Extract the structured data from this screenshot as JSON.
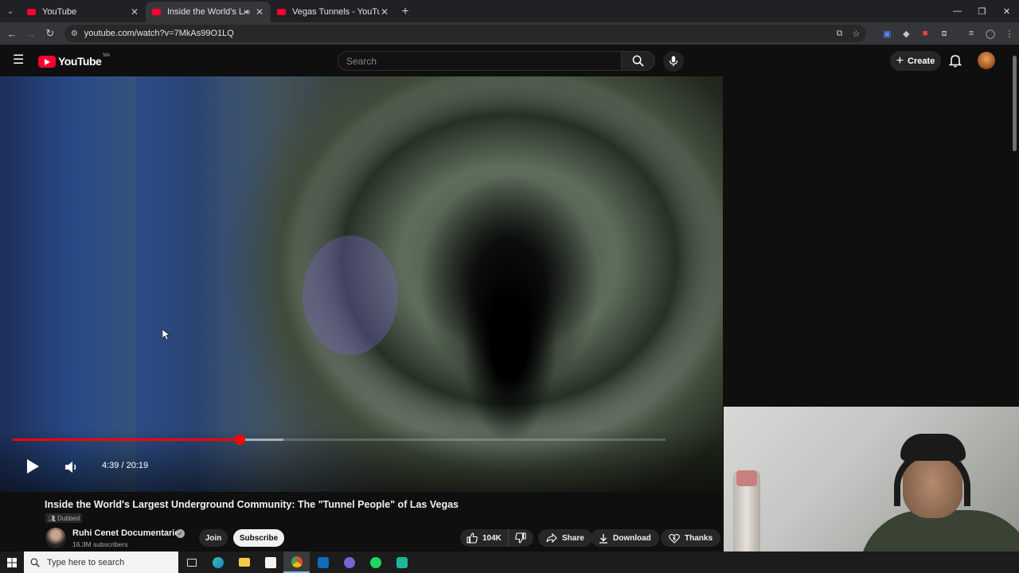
{
  "browser": {
    "tabs": [
      {
        "title": "YouTube",
        "active": false
      },
      {
        "title": "Inside the World's Largest U",
        "active": true
      },
      {
        "title": "Vegas Tunnels - YouTube",
        "active": false
      }
    ],
    "url": "youtube.com/watch?v=7MkAs99O1LQ"
  },
  "youtube": {
    "logo_text": "YouTube",
    "country_code": "MA",
    "search_placeholder": "Search",
    "create_label": "Create"
  },
  "player": {
    "time_display": "4:39 / 20:19",
    "progress_fraction": 0.348,
    "buffered_fraction": 0.415
  },
  "video": {
    "title": "Inside the World's Largest Underground Community: The \"Tunnel People\" of Las Vegas",
    "badge": "Dubbed",
    "channel_name": "Ruhi Cenet Documentaries",
    "subscribers": "16.3M subscribers",
    "join_label": "Join",
    "subscribe_label": "Subscribe",
    "like_count": "104K",
    "share_label": "Share",
    "download_label": "Download",
    "thanks_label": "Thanks"
  },
  "taskbar": {
    "search_placeholder": "Type here to search"
  },
  "colors": {
    "brand_red": "#ff0033",
    "progress_red": "#ff0000",
    "background": "#0f0f0f"
  }
}
